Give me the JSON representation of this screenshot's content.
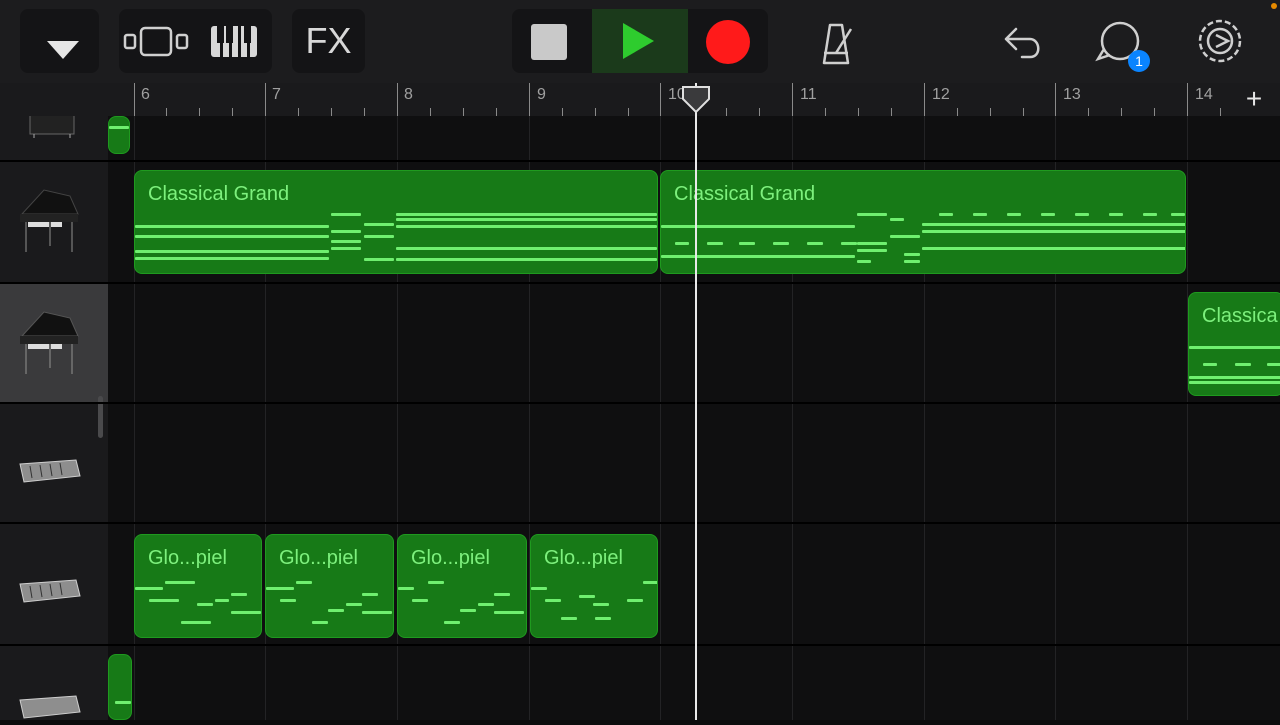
{
  "toolbar": {
    "fx_label": "FX",
    "notification_count": "1"
  },
  "ruler": {
    "bars": [
      "6",
      "7",
      "8",
      "9",
      "10",
      "11",
      "12",
      "13",
      "14"
    ]
  },
  "tracks": [
    {
      "instrument": "piano-icon"
    },
    {
      "instrument": "grand-piano-icon"
    },
    {
      "instrument": "grand-piano-icon",
      "selected": true
    },
    {
      "instrument": "glockenspiel-icon"
    },
    {
      "instrument": "glockenspiel-icon"
    },
    {
      "instrument": "glockenspiel-icon"
    }
  ],
  "regions": {
    "grand_1": "Classical Grand",
    "grand_2": "Classical Grand",
    "grand_3": "Classica",
    "glock_1": "Glo...piel",
    "glock_2": "Glo...piel",
    "glock_3": "Glo...piel",
    "glock_4": "Glo...piel"
  },
  "colors": {
    "region_green": "#177a17",
    "note_green": "#6fef6f",
    "play": "#2ecc2e",
    "record": "#ff1a1a",
    "badge": "#0a84ff"
  }
}
